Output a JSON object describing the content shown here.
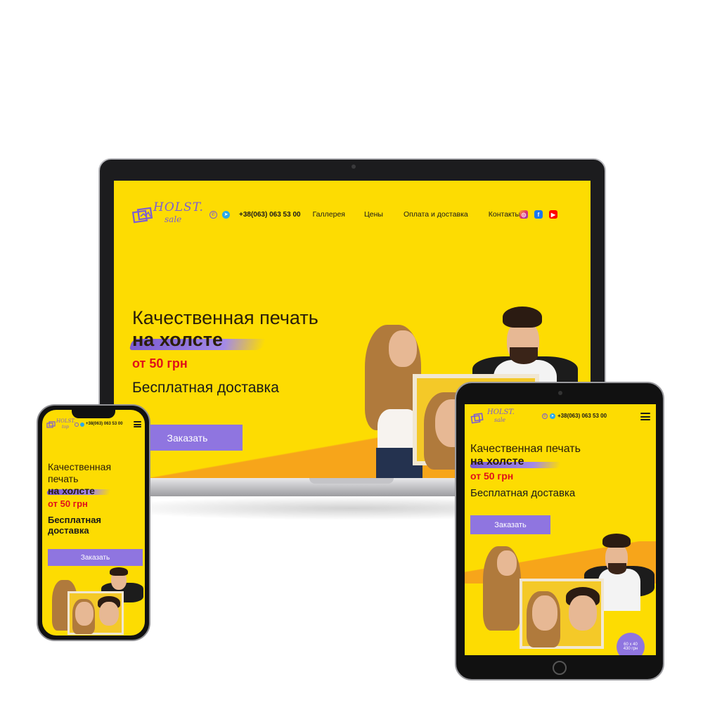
{
  "brand": {
    "logo_text": "HOLST.",
    "logo_subtext_laptop": "sale",
    "logo_subtext_phone": "top"
  },
  "header": {
    "phone": "+38(063) 063 53 00",
    "nav": [
      "Галлерея",
      "Цены",
      "Оплата и доставка",
      "Контакты"
    ],
    "social": [
      "instagram-icon",
      "facebook-icon",
      "youtube-icon"
    ],
    "messengers": [
      "viber-icon",
      "telegram-icon"
    ]
  },
  "hero": {
    "title_line1": "Качественная печать",
    "title_line2": "на холсте",
    "phone_title_line1": "Качественная",
    "phone_title_line2": "печать",
    "price": "от 50 грн",
    "delivery": "Бесплатная доставка",
    "delivery_line1": "Бесплатная",
    "delivery_line2": "доставка",
    "cta": "Заказать"
  },
  "badge": {
    "size": "60 x 40",
    "price": "430 грн"
  },
  "colors": {
    "background_yellow": "#fddc02",
    "accent_purple": "#8f75e0",
    "price_red": "#e0111a",
    "band_orange": "#f7a51a"
  }
}
